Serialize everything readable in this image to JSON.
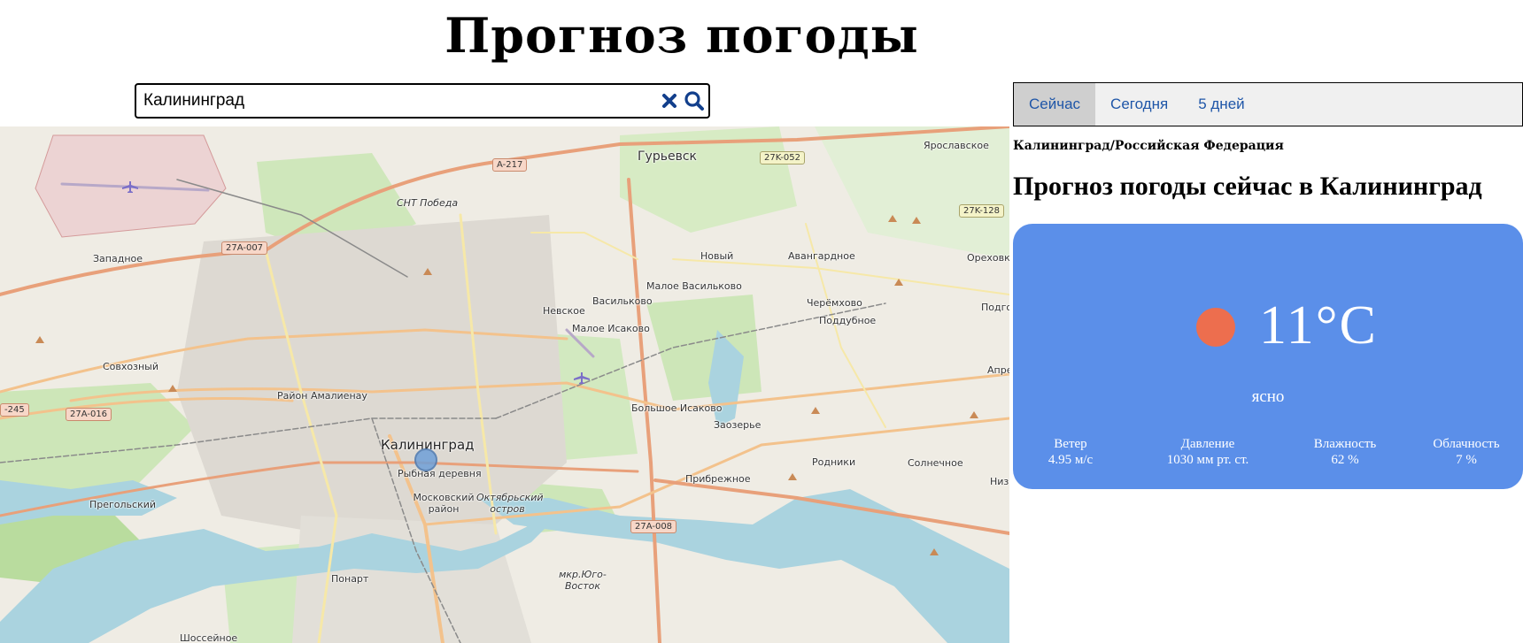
{
  "header": {
    "title": "Прогноз погоды"
  },
  "search": {
    "value": "Калининград",
    "clear_icon": "close-icon",
    "search_icon": "search-icon"
  },
  "map": {
    "labels": {
      "gurievsk": "Гурьевск",
      "yaroslavskoe": "Ярославское",
      "snt_pobeda": "СНТ Победа",
      "zapadnoe": "Западное",
      "novyy": "Новый",
      "avangardnoe": "Авангардное",
      "orekhovka": "Ореховка",
      "maloe_vasilkovo": "Малое Васильково",
      "nevskoe": "Невское",
      "vasilkovo": "Васильково",
      "cheremkhovo": "Черёмхово",
      "poddubnoe": "Поддубное",
      "podgo": "Подго",
      "maloe_isakovo": "Малое Исаково",
      "sovkhozny": "Совхозный",
      "apre": "Апре",
      "rayon_amalienau": "Район Амалиенау",
      "bolshoe_isakovo": "Большое Исаково",
      "zaozerye": "Заозерье",
      "kaliningrad": "Калининград",
      "rybnaya_derevnya": "Рыбная деревня",
      "rodniki": "Родники",
      "solnechnoe": "Солнечное",
      "nizh": "Низ",
      "pregolsky": "Прегольский",
      "moskovsky": "Московский район",
      "oktyabrsky": "Октябрьский остров",
      "pribrezhnoe": "Прибрежное",
      "ponart": "Понарт",
      "mkr_yugo_vostok": "мкр.Юго-Восток",
      "shosseynoe": "Шоссейное"
    },
    "shields": {
      "a217": "A-217",
      "k052": "27K-052",
      "k128": "27K-128",
      "a007": "27A-007",
      "a016": "27A-016",
      "k245": "-245",
      "a008": "27A-008"
    }
  },
  "tabs": [
    "Сейчас",
    "Сегодня",
    "5 дней"
  ],
  "location": "Калининград/Российская Федерация",
  "forecast_heading": "Прогноз погоды сейчас в Калининград",
  "weather": {
    "temperature": "11°C",
    "condition": "ясно",
    "icon": "sun-icon",
    "stats": [
      {
        "label": "Ветер",
        "value": "4.95 м/с"
      },
      {
        "label": "Давление",
        "value": "1030 мм рт. ст."
      },
      {
        "label": "Влажность",
        "value": "62 %"
      },
      {
        "label": "Облачность",
        "value": "7 %"
      }
    ]
  },
  "colors": {
    "card": "#5b8fe9",
    "sun": "#ed6e4e",
    "tab_text": "#1f56a8",
    "active_tab": "#cfcfcf"
  }
}
